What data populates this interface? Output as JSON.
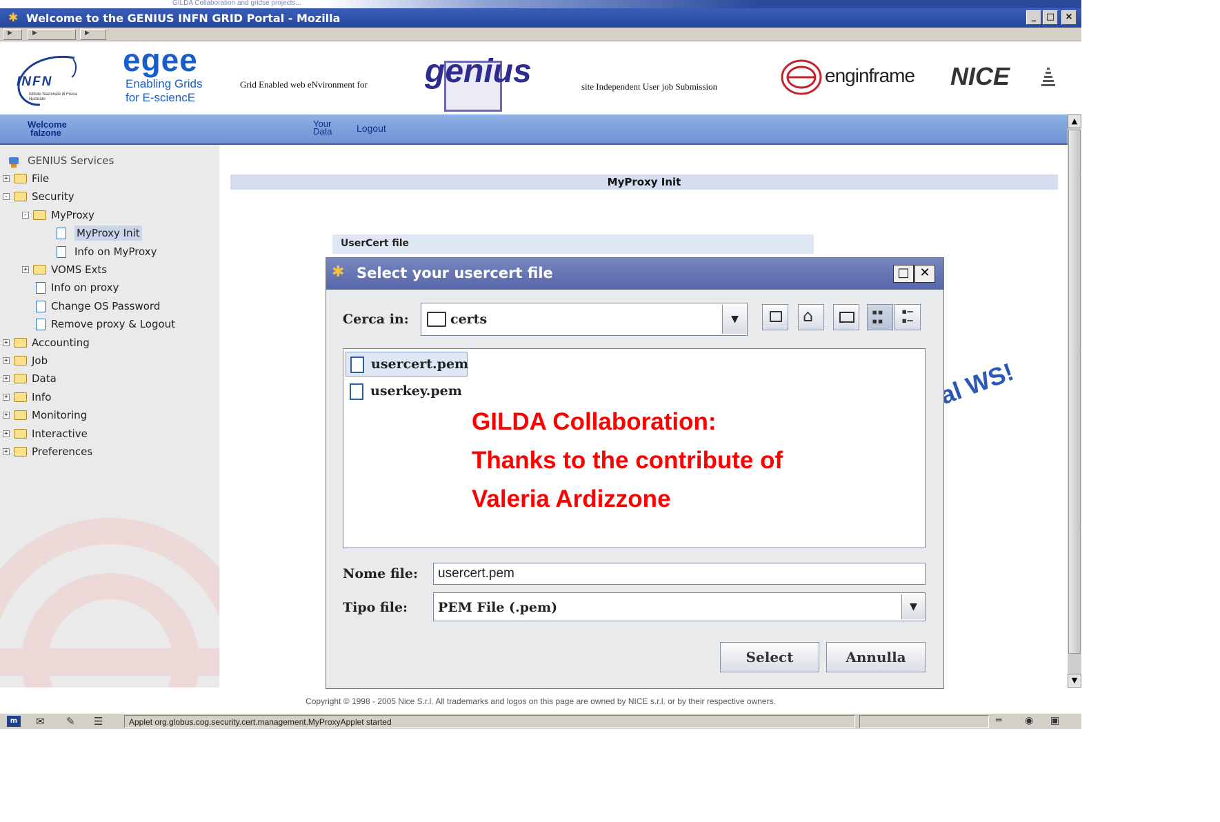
{
  "browser": {
    "title": "Welcome to the GENIUS INFN GRID Portal - Mozilla",
    "top_caption": "GILDA Collaboration and  gridse projects...",
    "window_buttons": [
      "_",
      "□",
      "×"
    ]
  },
  "header": {
    "infn": "INFN",
    "infn_sub": "Istituto Nazionale di Fisica Nucleare",
    "egee": "egee",
    "egee_sub1": "Enabling Grids",
    "egee_sub2": "for E-sciencE",
    "genius_caption": "Grid Enabled web eNvironment for",
    "genius_logo": "genius",
    "site_caption": "site Independent User job Submission",
    "enginframe": "enginframe",
    "nice": "NICE"
  },
  "nav": {
    "welcome_line1": "Welcome",
    "welcome_line2": "falzone",
    "your_data_line1": "Your",
    "your_data_line2": "Data",
    "logout": "Logout"
  },
  "sidebar": {
    "root": "GENIUS Services",
    "items": [
      {
        "label": "File",
        "level": 0,
        "kind": "folder",
        "expander": "+"
      },
      {
        "label": "Security",
        "level": 0,
        "kind": "folder",
        "expander": "-"
      },
      {
        "label": "MyProxy",
        "level": 1,
        "kind": "folder",
        "expander": "-"
      },
      {
        "label": "MyProxy Init",
        "level": 2,
        "kind": "doc",
        "selected": true
      },
      {
        "label": "Info on MyProxy",
        "level": 2,
        "kind": "doc"
      },
      {
        "label": "VOMS Exts",
        "level": 1,
        "kind": "folder",
        "expander": "+"
      },
      {
        "label": "Info on proxy",
        "level": 1,
        "kind": "doc"
      },
      {
        "label": "Change OS Password",
        "level": 1,
        "kind": "doc"
      },
      {
        "label": "Remove proxy & Logout",
        "level": 1,
        "kind": "doc"
      },
      {
        "label": "Accounting",
        "level": 0,
        "kind": "folder",
        "expander": "+"
      },
      {
        "label": "Job",
        "level": 0,
        "kind": "folder",
        "expander": "+"
      },
      {
        "label": "Data",
        "level": 0,
        "kind": "folder",
        "expander": "+"
      },
      {
        "label": "Info",
        "level": 0,
        "kind": "folder",
        "expander": "+"
      },
      {
        "label": "Monitoring",
        "level": 0,
        "kind": "folder",
        "expander": "+"
      },
      {
        "label": "Interactive",
        "level": 0,
        "kind": "folder",
        "expander": "+"
      },
      {
        "label": "Preferences",
        "level": 0,
        "kind": "folder",
        "expander": "+"
      }
    ]
  },
  "main": {
    "section_title": "MyProxy Init",
    "usercert_label": "UserCert file",
    "overlay_ws": "ocal WS!"
  },
  "dialog": {
    "title": "Select your usercert file",
    "look_in_label": "Cerca in:",
    "look_in_value": "certs",
    "files": [
      "usercert.pem",
      "userkey.pem"
    ],
    "selected_file": "usercert.pem",
    "filename_label": "Nome file:",
    "filename_value": "usercert.pem",
    "filetype_label": "Tipo file:",
    "filetype_value": "PEM File (.pem)",
    "select_button": "Select",
    "cancel_button": "Annulla"
  },
  "annotation": {
    "line1": "GILDA Collaboration:",
    "line2": "Thanks to the contribute of",
    "line3": "Valeria Ardizzone"
  },
  "footer": {
    "copyright": "Copyright © 1998 - 2005 Nice S.r.l. All trademarks and logos on this page are owned by NICE s.r.l. or by their respective owners."
  },
  "status": {
    "message": "Applet org.globus.cog.security.cert.management.MyProxyApplet started"
  },
  "colors": {
    "title_blue": "#2c4ca2",
    "nav_blue": "#7e9fde",
    "annotation_red": "#ff0000",
    "egee_blue": "#1a5cc8",
    "egee_orange": "#f08a00"
  }
}
